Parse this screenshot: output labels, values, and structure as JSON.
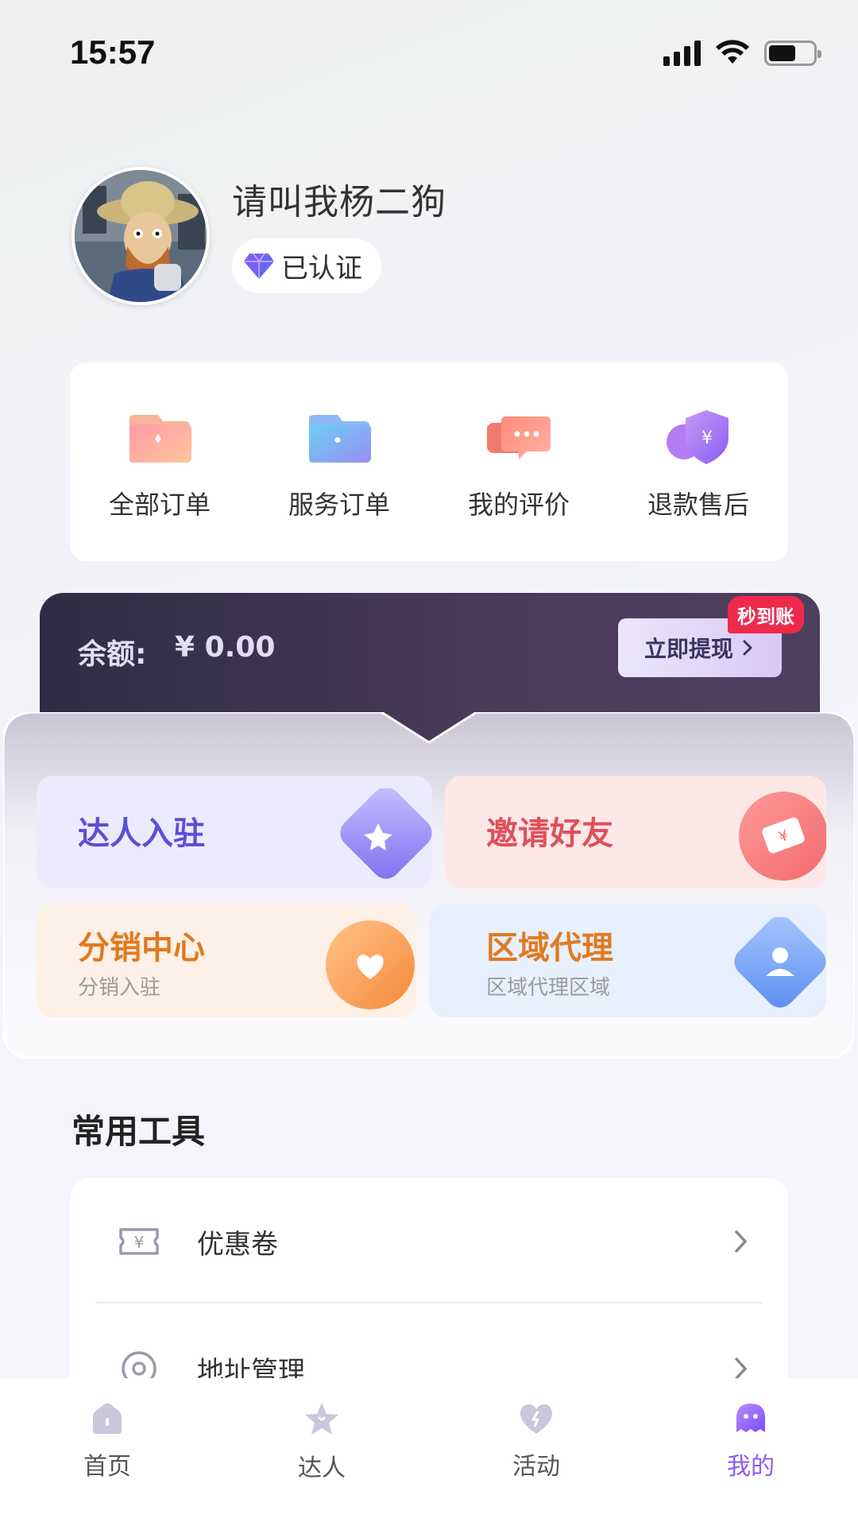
{
  "status_bar": {
    "time": "15:57"
  },
  "profile": {
    "username": "请叫我杨二狗",
    "verified_label": "已认证"
  },
  "orders": [
    {
      "label": "全部订单",
      "icon": "folder-pink-icon"
    },
    {
      "label": "服务订单",
      "icon": "folder-blue-icon"
    },
    {
      "label": "我的评价",
      "icon": "chat-bubble-icon"
    },
    {
      "label": "退款售后",
      "icon": "shield-yen-icon"
    }
  ],
  "balance": {
    "label": "余额:",
    "amount": "¥ 0.00",
    "withdraw_label": "立即提现",
    "instant_tag": "秒到账"
  },
  "features": [
    {
      "title": "达人入驻",
      "subtitle": "",
      "color": "#5b4fd6",
      "icon": "star-icon"
    },
    {
      "title": "邀请好友",
      "subtitle": "",
      "color": "#e0505a",
      "icon": "ticket-icon"
    },
    {
      "title": "分销中心",
      "subtitle": "分销入驻",
      "color": "#e07a1e",
      "icon": "heart-icon"
    },
    {
      "title": "区域代理",
      "subtitle": "区域代理区域",
      "color": "#e07a1e",
      "icon": "user-icon"
    }
  ],
  "tools": {
    "title": "常用工具",
    "items": [
      {
        "label": "优惠卷",
        "icon": "coupon-icon"
      },
      {
        "label": "地址管理",
        "icon": "location-icon"
      }
    ]
  },
  "tabs": [
    {
      "label": "首页",
      "icon": "home-icon",
      "active": false
    },
    {
      "label": "达人",
      "icon": "star-icon",
      "active": false
    },
    {
      "label": "活动",
      "icon": "heart-bolt-icon",
      "active": false
    },
    {
      "label": "我的",
      "icon": "ghost-icon",
      "active": true
    }
  ],
  "colors": {
    "accent": "#8b5cf6",
    "balance_bg": "#3a3550",
    "instant_tag": "#ee2a4a"
  }
}
